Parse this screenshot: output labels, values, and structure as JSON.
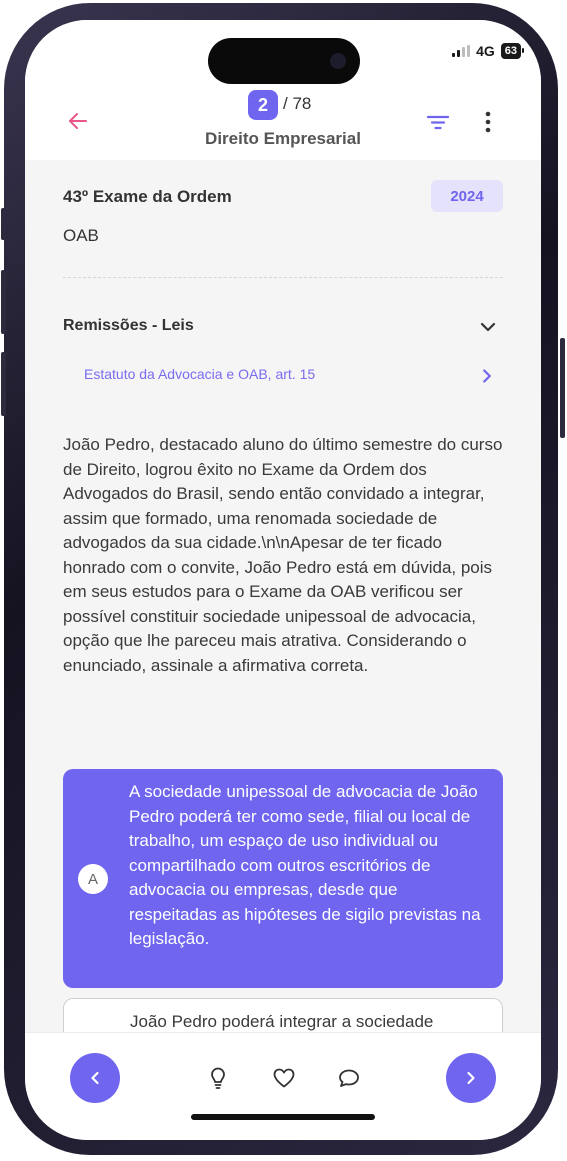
{
  "status_bar": {
    "network": "4G",
    "battery": "63"
  },
  "header": {
    "back_icon": "arrow-left-icon",
    "question_number": "2",
    "question_total": "/ 78",
    "subject": "Direito Empresarial",
    "filter_icon": "filter-icon",
    "more_icon": "more-vertical-icon"
  },
  "exam": {
    "title": "43º Exame da Ordem",
    "year": "2024",
    "organization": "OAB"
  },
  "remissoes": {
    "title": "Remissões - Leis",
    "items": [
      {
        "label": "Estatuto da Advocacia e OAB, art. 15"
      }
    ]
  },
  "question": {
    "text": "João Pedro, destacado aluno do último semestre do curso de Direito, logrou êxito no Exame da Ordem dos Advogados do Brasil, sendo então convidado a integrar, assim que formado, uma renomada sociedade de advogados da sua cidade.\\n\\nApesar de ter ficado honrado com o convite, João Pedro está em dúvida, pois em seus estudos para o Exame da OAB verificou ser possível constituir sociedade unipessoal de advocacia, opção que lhe pareceu mais atrativa. Considerando o enunciado, assinale a afirmativa correta."
  },
  "options": [
    {
      "letter": "A",
      "text": "A sociedade unipessoal de advocacia de João Pedro poderá ter como sede, filial ou local de trabalho, um espaço de uso individual ou compartilhado com outros escritórios de advocacia ou empresas, desde que respeitadas as hipóteses de sigilo previstas na legislação."
    },
    {
      "letter": "",
      "text": "João Pedro poderá integrar a sociedade"
    }
  ],
  "bottom_bar": {
    "icons": [
      "chevron-left-icon",
      "lightbulb-icon",
      "heart-icon",
      "comment-icon",
      "chevron-right-icon"
    ]
  },
  "colors": {
    "accent": "#6F65EF",
    "back_arrow": "#E8578C",
    "badge_bg": "#E5E2FB"
  }
}
